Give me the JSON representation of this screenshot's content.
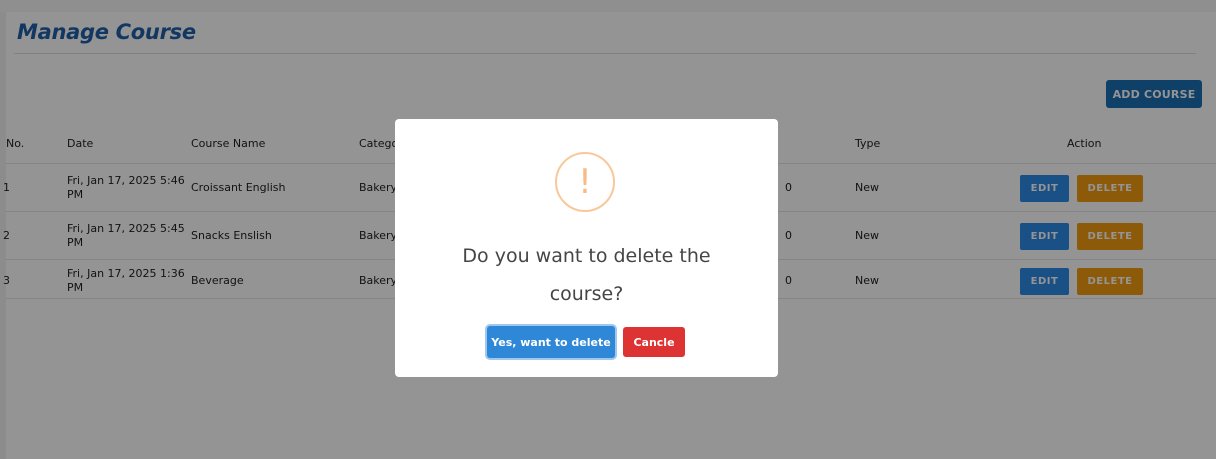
{
  "page": {
    "title": "Manage Course"
  },
  "toolbar": {
    "add_course_label": "ADD COURSE"
  },
  "table": {
    "headers": [
      "No.",
      "Date",
      "Course Name",
      "Catego",
      "Type",
      "Action"
    ],
    "rows": [
      {
        "no": "1",
        "date_line1": "Fri, Jan 17, 2025 5:46",
        "date_line2": "PM",
        "course_name": "Croissant English",
        "category": "Bakery",
        "hidden_col": "0",
        "type": "New",
        "edit": "EDIT",
        "delete": "DELETE"
      },
      {
        "no": "2",
        "date_line1": "Fri, Jan 17, 2025 5:45",
        "date_line2": "PM",
        "course_name": "Snacks Enslish",
        "category": "Bakery",
        "hidden_col": "0",
        "type": "New",
        "edit": "EDIT",
        "delete": "DELETE"
      },
      {
        "no": "3",
        "date_line1": "Fri, Jan 17, 2025 1:36",
        "date_line2": "PM",
        "course_name": "Beverage",
        "category": "Bakery",
        "hidden_col": "0",
        "type": "New",
        "edit": "EDIT",
        "delete": "DELETE"
      }
    ]
  },
  "modal": {
    "icon": "exclamation-icon",
    "icon_glyph": "!",
    "message_line1": "Do you want to delete the",
    "message_line2": "course?",
    "confirm_label": "Yes, want to delete",
    "cancel_label": "Cancle"
  },
  "colors": {
    "title": "#1f5fa8",
    "add_button": "#1b6eb4",
    "edit_button": "#2b8be5",
    "delete_button": "#f39c12",
    "confirm_button": "#2f87d8",
    "cancel_button": "#dd3333",
    "warning_icon": "#f8bb86"
  }
}
